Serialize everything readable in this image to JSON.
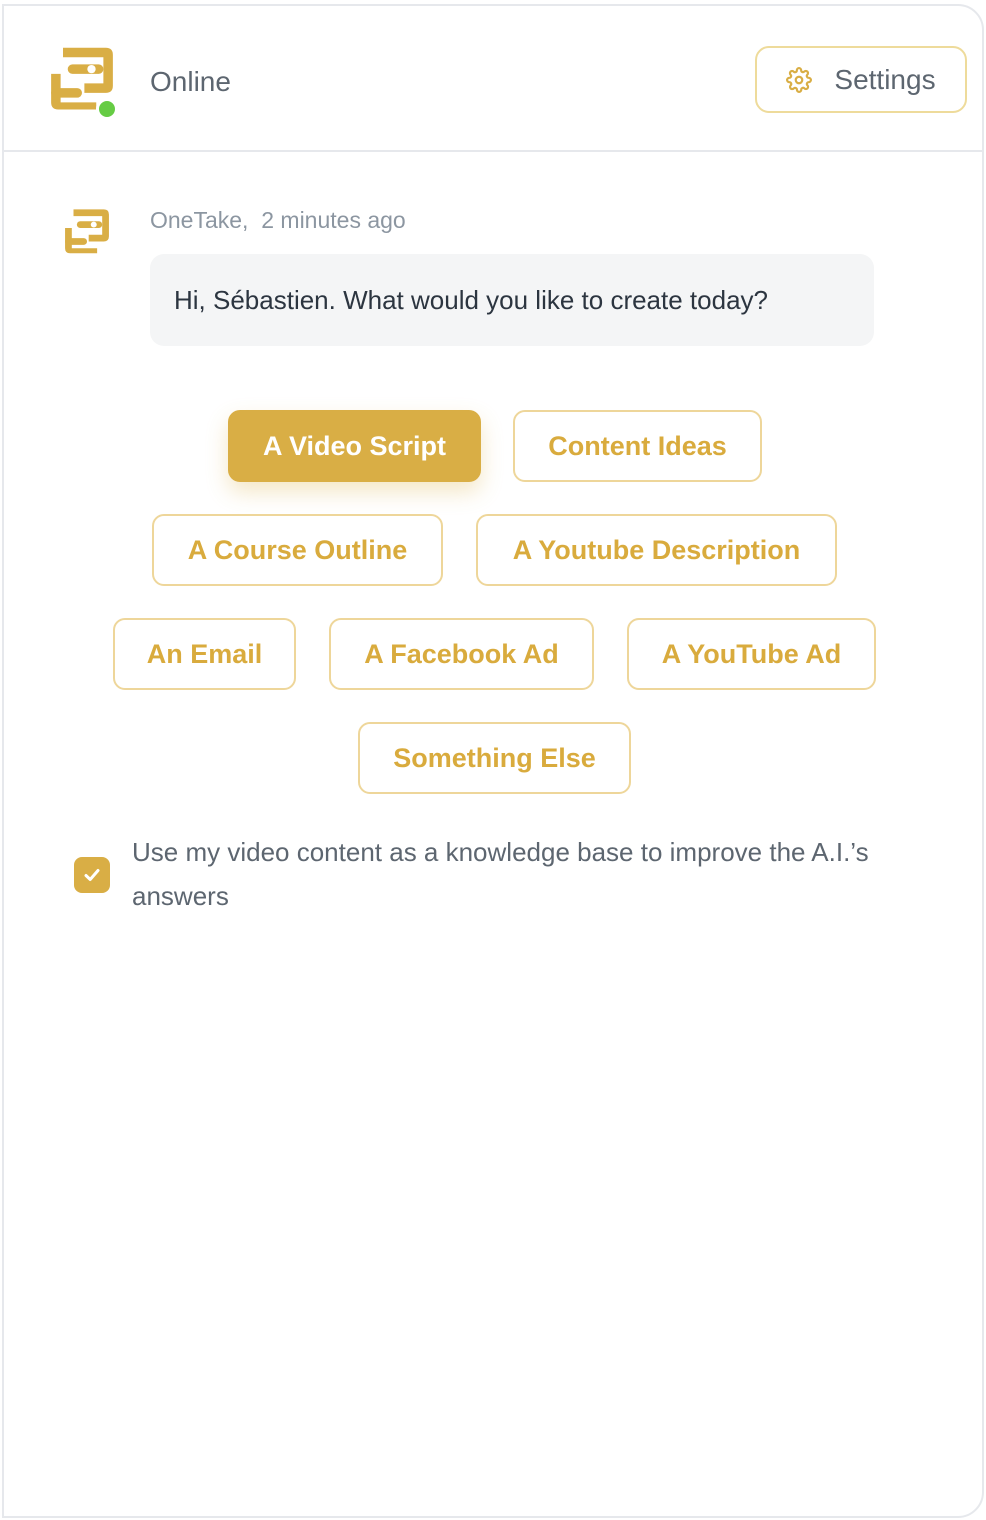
{
  "header": {
    "status": "Online",
    "settings_label": "Settings",
    "status_color": "#66cc44"
  },
  "message": {
    "sender": "OneTake,",
    "time": "2 minutes ago",
    "text": "Hi, Sébastien. What would you like to create today?"
  },
  "options": [
    {
      "label": "A Video Script",
      "selected": true
    },
    {
      "label": "Content Ideas",
      "selected": false
    },
    {
      "label": "A Course Outline",
      "selected": false
    },
    {
      "label": "A Youtube Description",
      "selected": false
    },
    {
      "label": "An Email",
      "selected": false
    },
    {
      "label": "A Facebook Ad",
      "selected": false
    },
    {
      "label": "A YouTube Ad",
      "selected": false
    },
    {
      "label": "Something Else",
      "selected": false
    }
  ],
  "knowledge_base": {
    "checked": true,
    "label": "Use my video content as a knowledge base to improve the A.I.’s answers"
  },
  "icons": {
    "logo": "onetake-logo-icon",
    "settings": "gear-icon",
    "checkbox": "checkmark-icon"
  },
  "colors": {
    "accent": "#d9ae45",
    "accent_border": "#eed69a",
    "bubble_bg": "#f4f5f6",
    "text_muted": "#5d6670"
  }
}
